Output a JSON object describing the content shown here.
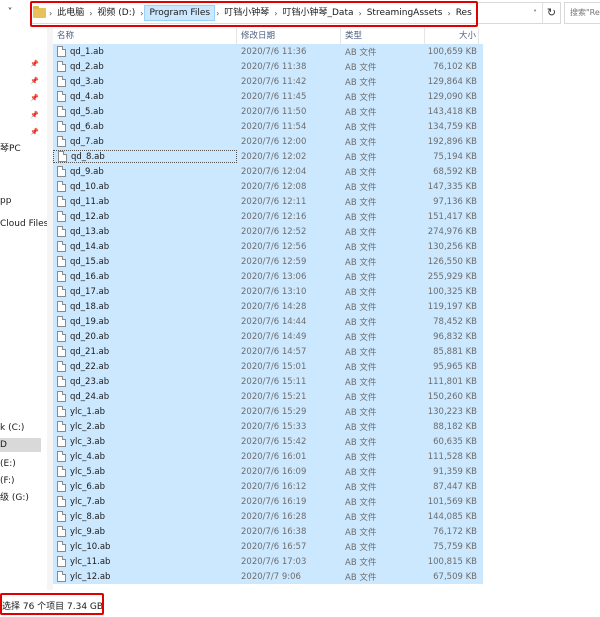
{
  "address": {
    "crumbs": [
      "此电脑",
      "视频 (D:)",
      "Program Files",
      "叮铛小钟琴",
      "叮铛小钟琴_Data",
      "StreamingAssets",
      "Res"
    ],
    "refresh_icon": "refresh-icon"
  },
  "search": {
    "placeholder": "搜索\"Re"
  },
  "nav": {
    "items": [
      "琴PC",
      "pp",
      "Cloud Files",
      "k (C:)",
      "D",
      "(E:)",
      "(F:)",
      "级 (G:)"
    ]
  },
  "columns": {
    "name": "名称",
    "date": "修改日期",
    "type": "类型",
    "size": "大小"
  },
  "files": [
    {
      "name": "qd_1.ab",
      "date": "2020/7/6 11:36",
      "type": "AB 文件",
      "size": "100,659 KB"
    },
    {
      "name": "qd_2.ab",
      "date": "2020/7/6 11:38",
      "type": "AB 文件",
      "size": "76,102 KB"
    },
    {
      "name": "qd_3.ab",
      "date": "2020/7/6 11:42",
      "type": "AB 文件",
      "size": "129,864 KB"
    },
    {
      "name": "qd_4.ab",
      "date": "2020/7/6 11:45",
      "type": "AB 文件",
      "size": "129,090 KB"
    },
    {
      "name": "qd_5.ab",
      "date": "2020/7/6 11:50",
      "type": "AB 文件",
      "size": "143,418 KB"
    },
    {
      "name": "qd_6.ab",
      "date": "2020/7/6 11:54",
      "type": "AB 文件",
      "size": "134,759 KB"
    },
    {
      "name": "qd_7.ab",
      "date": "2020/7/6 12:00",
      "type": "AB 文件",
      "size": "192,896 KB"
    },
    {
      "name": "qd_8.ab",
      "date": "2020/7/6 12:02",
      "type": "AB 文件",
      "size": "75,194 KB"
    },
    {
      "name": "qd_9.ab",
      "date": "2020/7/6 12:04",
      "type": "AB 文件",
      "size": "68,592 KB"
    },
    {
      "name": "qd_10.ab",
      "date": "2020/7/6 12:08",
      "type": "AB 文件",
      "size": "147,335 KB"
    },
    {
      "name": "qd_11.ab",
      "date": "2020/7/6 12:11",
      "type": "AB 文件",
      "size": "97,136 KB"
    },
    {
      "name": "qd_12.ab",
      "date": "2020/7/6 12:16",
      "type": "AB 文件",
      "size": "151,417 KB"
    },
    {
      "name": "qd_13.ab",
      "date": "2020/7/6 12:52",
      "type": "AB 文件",
      "size": "274,976 KB"
    },
    {
      "name": "qd_14.ab",
      "date": "2020/7/6 12:56",
      "type": "AB 文件",
      "size": "130,256 KB"
    },
    {
      "name": "qd_15.ab",
      "date": "2020/7/6 12:59",
      "type": "AB 文件",
      "size": "126,550 KB"
    },
    {
      "name": "qd_16.ab",
      "date": "2020/7/6 13:06",
      "type": "AB 文件",
      "size": "255,929 KB"
    },
    {
      "name": "qd_17.ab",
      "date": "2020/7/6 13:10",
      "type": "AB 文件",
      "size": "100,325 KB"
    },
    {
      "name": "qd_18.ab",
      "date": "2020/7/6 14:28",
      "type": "AB 文件",
      "size": "119,197 KB"
    },
    {
      "name": "qd_19.ab",
      "date": "2020/7/6 14:44",
      "type": "AB 文件",
      "size": "78,452 KB"
    },
    {
      "name": "qd_20.ab",
      "date": "2020/7/6 14:49",
      "type": "AB 文件",
      "size": "96,832 KB"
    },
    {
      "name": "qd_21.ab",
      "date": "2020/7/6 14:57",
      "type": "AB 文件",
      "size": "85,881 KB"
    },
    {
      "name": "qd_22.ab",
      "date": "2020/7/6 15:01",
      "type": "AB 文件",
      "size": "95,965 KB"
    },
    {
      "name": "qd_23.ab",
      "date": "2020/7/6 15:11",
      "type": "AB 文件",
      "size": "111,801 KB"
    },
    {
      "name": "qd_24.ab",
      "date": "2020/7/6 15:21",
      "type": "AB 文件",
      "size": "150,260 KB"
    },
    {
      "name": "ylc_1.ab",
      "date": "2020/7/6 15:29",
      "type": "AB 文件",
      "size": "130,223 KB"
    },
    {
      "name": "ylc_2.ab",
      "date": "2020/7/6 15:33",
      "type": "AB 文件",
      "size": "88,182 KB"
    },
    {
      "name": "ylc_3.ab",
      "date": "2020/7/6 15:42",
      "type": "AB 文件",
      "size": "60,635 KB"
    },
    {
      "name": "ylc_4.ab",
      "date": "2020/7/6 16:01",
      "type": "AB 文件",
      "size": "111,528 KB"
    },
    {
      "name": "ylc_5.ab",
      "date": "2020/7/6 16:09",
      "type": "AB 文件",
      "size": "91,359 KB"
    },
    {
      "name": "ylc_6.ab",
      "date": "2020/7/6 16:12",
      "type": "AB 文件",
      "size": "87,447 KB"
    },
    {
      "name": "ylc_7.ab",
      "date": "2020/7/6 16:19",
      "type": "AB 文件",
      "size": "101,569 KB"
    },
    {
      "name": "ylc_8.ab",
      "date": "2020/7/6 16:28",
      "type": "AB 文件",
      "size": "144,085 KB"
    },
    {
      "name": "ylc_9.ab",
      "date": "2020/7/6 16:38",
      "type": "AB 文件",
      "size": "76,172 KB"
    },
    {
      "name": "ylc_10.ab",
      "date": "2020/7/6 16:57",
      "type": "AB 文件",
      "size": "75,759 KB"
    },
    {
      "name": "ylc_11.ab",
      "date": "2020/7/6 17:03",
      "type": "AB 文件",
      "size": "100,815 KB"
    },
    {
      "name": "ylc_12.ab",
      "date": "2020/7/7 9:06",
      "type": "AB 文件",
      "size": "67,509 KB"
    }
  ],
  "status": {
    "text": "选择 76 个项目  7.34 GB"
  },
  "colors": {
    "selection": "#cce8ff",
    "highlight_border": "#e00000"
  }
}
